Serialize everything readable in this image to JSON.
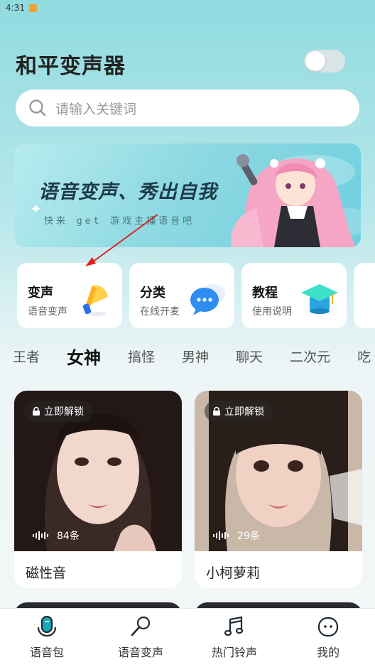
{
  "status_bar": {
    "time": "4:31"
  },
  "header": {
    "title": "和平变声器"
  },
  "search": {
    "placeholder": "请输入关键词"
  },
  "banner": {
    "headline": "语音变声、秀出自我",
    "subtext": "快来 get 游戏主播语音吧"
  },
  "feature_cards": [
    {
      "title": "变声",
      "subtitle": "语音变声",
      "icon": "megaphone-icon"
    },
    {
      "title": "分类",
      "subtitle": "在线开麦",
      "icon": "chat-bubble-icon"
    },
    {
      "title": "教程",
      "subtitle": "使用说明",
      "icon": "graduation-cap-icon"
    }
  ],
  "category_tabs": [
    "王者",
    "女神",
    "搞怪",
    "男神",
    "聊天",
    "二次元",
    "吃"
  ],
  "active_tab": "女神",
  "voice_packs": [
    {
      "lock_label": "立即解锁",
      "count": "84条",
      "name": "磁性音"
    },
    {
      "lock_label": "立即解锁",
      "count": "29条",
      "name": "小柯萝莉"
    }
  ],
  "bottom_nav": [
    {
      "label": "语音包",
      "icon": "microphone-icon",
      "active": true
    },
    {
      "label": "语音变声",
      "icon": "voice-change-icon",
      "active": false
    },
    {
      "label": "热门铃声",
      "icon": "music-note-icon",
      "active": false
    },
    {
      "label": "我的",
      "icon": "profile-face-icon",
      "active": false
    }
  ],
  "colors": {
    "accent": "#1aa7b8",
    "annotation_arrow": "#e02020"
  }
}
